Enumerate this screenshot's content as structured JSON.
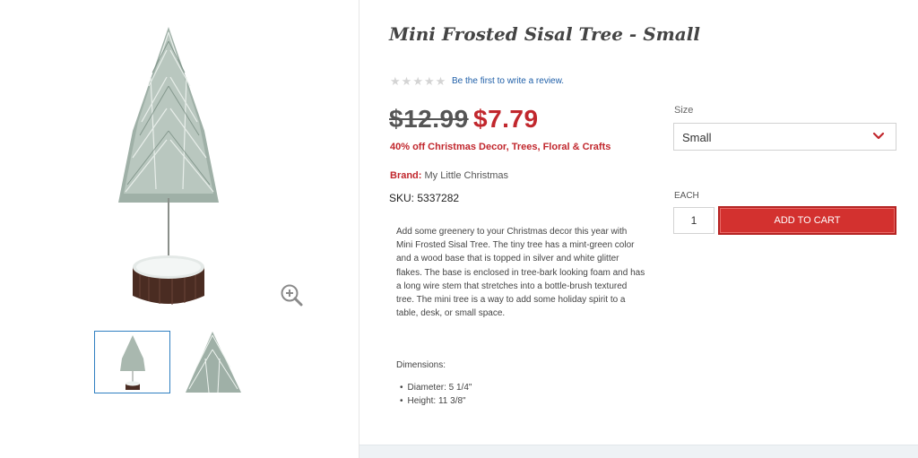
{
  "product": {
    "title": "Mini Frosted Sisal Tree - Small",
    "review_link": "Be the first to write a review.",
    "rating_stars": 0,
    "price_old": "$12.99",
    "price_new": "$7.79",
    "promo": "40% off Christmas Decor, Trees, Floral & Crafts",
    "brand_label": "Brand:",
    "brand_value": "My Little Christmas",
    "sku": "SKU: 5337282",
    "description": "Add some greenery to your Christmas decor this year with Mini Frosted Sisal Tree. The tiny tree has a mint-green color and a wood base that is topped in silver and white glitter flakes. The base is enclosed in tree-bark looking foam and has a long wire stem that stretches into a bottle-brush textured tree. The mini tree is a way to add some holiday spirit to a table, desk, or small space.",
    "dimensions_title": "Dimensions:",
    "dimensions": [
      "Diameter: 5 1/4\"",
      "Height: 11 3/8\""
    ]
  },
  "purchase": {
    "size_label": "Size",
    "size_value": "Small",
    "unit_label": "EACH",
    "quantity": "1",
    "add_to_cart": "ADD TO CART"
  },
  "gallery": {
    "main_image": "frosted-sisal-tree-photo",
    "zoom_icon": "zoom-in-icon",
    "thumbnails": [
      "tree-full-thumbnail",
      "tree-closeup-thumbnail"
    ],
    "selected_thumbnail": 0
  },
  "colors": {
    "accent_red": "#c1272d",
    "button_red": "#d3312f",
    "link_blue": "#1f5fa8",
    "selected_border": "#2f7fc1"
  }
}
